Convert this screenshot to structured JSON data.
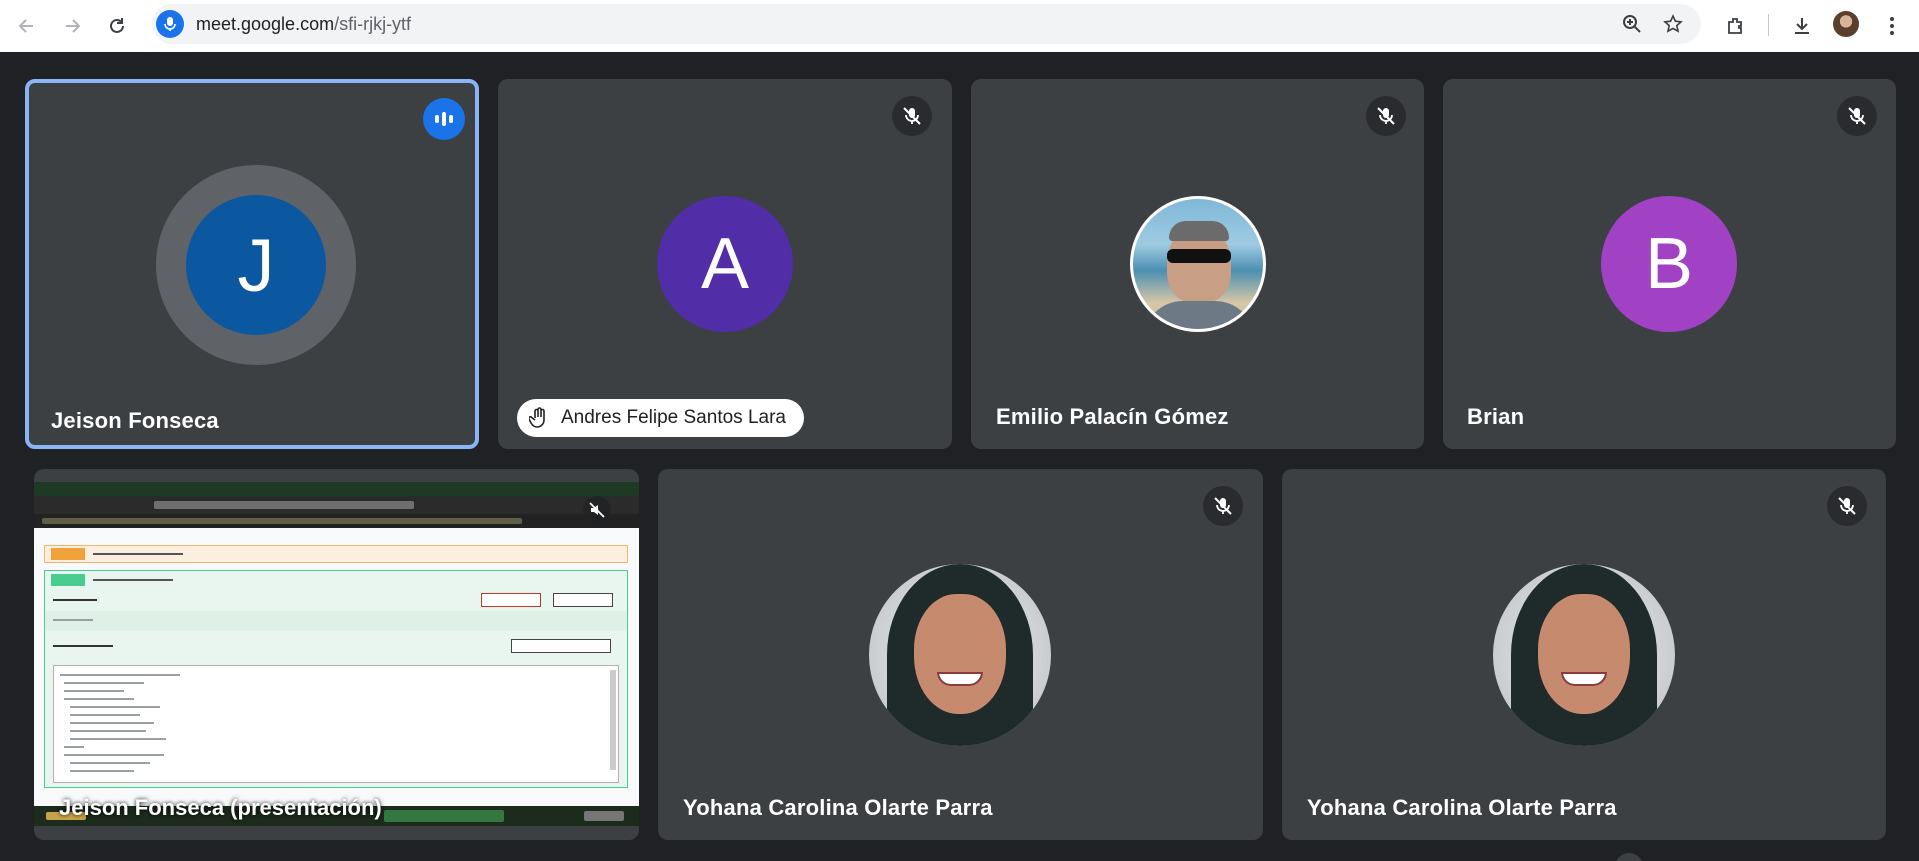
{
  "browser": {
    "url_host": "meet.google.com",
    "url_path": "/sfi-rjkj-ytf"
  },
  "participants": [
    {
      "name": "Jeison Fonseca",
      "initial": "J",
      "color": "#0b57a0",
      "state": "speaking"
    },
    {
      "name": "Andres Felipe Santos Lara",
      "initial": "A",
      "color": "#512da8",
      "state": "hand-raised-muted"
    },
    {
      "name": "Emilio Palacín Gómez",
      "state": "muted"
    },
    {
      "name": "Brian",
      "initial": "B",
      "color": "#a142c4",
      "state": "muted"
    },
    {
      "name": "Jeison Fonseca (presentación)",
      "state": "presenting"
    },
    {
      "name": "Yohana Carolina Olarte Parra",
      "state": "muted"
    },
    {
      "name": "Yohana Carolina Olarte Parra",
      "state": "muted"
    }
  ],
  "colors": {
    "background": "#202124",
    "tile": "#3c4043",
    "active_border": "#8ab4f8",
    "accent": "#1a73e8"
  }
}
